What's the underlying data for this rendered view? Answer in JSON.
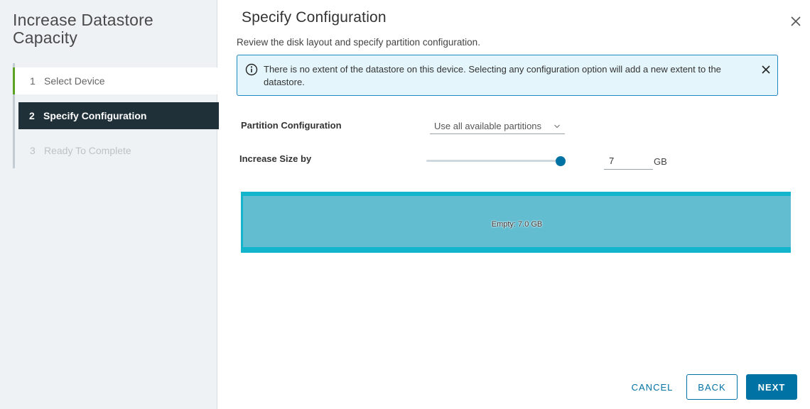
{
  "wizard": {
    "title": "Increase Datastore Capacity",
    "steps": [
      {
        "num": "1",
        "label": "Select Device",
        "state": "completed"
      },
      {
        "num": "2",
        "label": "Specify Configuration",
        "state": "active"
      },
      {
        "num": "3",
        "label": "Ready To Complete",
        "state": "disabled"
      }
    ]
  },
  "page": {
    "title": "Specify Configuration",
    "subtitle": "Review the disk layout and specify partition configuration.",
    "close_icon": "close-icon"
  },
  "alert": {
    "icon": "info-icon",
    "text": "There is no extent of the datastore on this device. Selecting any configuration option will add a new extent to the datastore.",
    "close_icon": "close-icon"
  },
  "form": {
    "partition_label": "Partition Configuration",
    "partition_value": "Use all available partitions",
    "increase_label": "Increase Size by",
    "slider_fraction": 1.0,
    "size_value": "7",
    "size_unit": "GB"
  },
  "disk": {
    "label": "Empty: 7.0 GB"
  },
  "buttons": {
    "cancel": "CANCEL",
    "back": "BACK",
    "next": "NEXT"
  },
  "colors": {
    "accent": "#0072a3",
    "active_step_bg": "#1f3038",
    "completed_step_marker": "#5aa220",
    "alert_bg": "#e4f5fb",
    "disk_border": "#12b5cb",
    "disk_fill": "#62bdd1"
  }
}
